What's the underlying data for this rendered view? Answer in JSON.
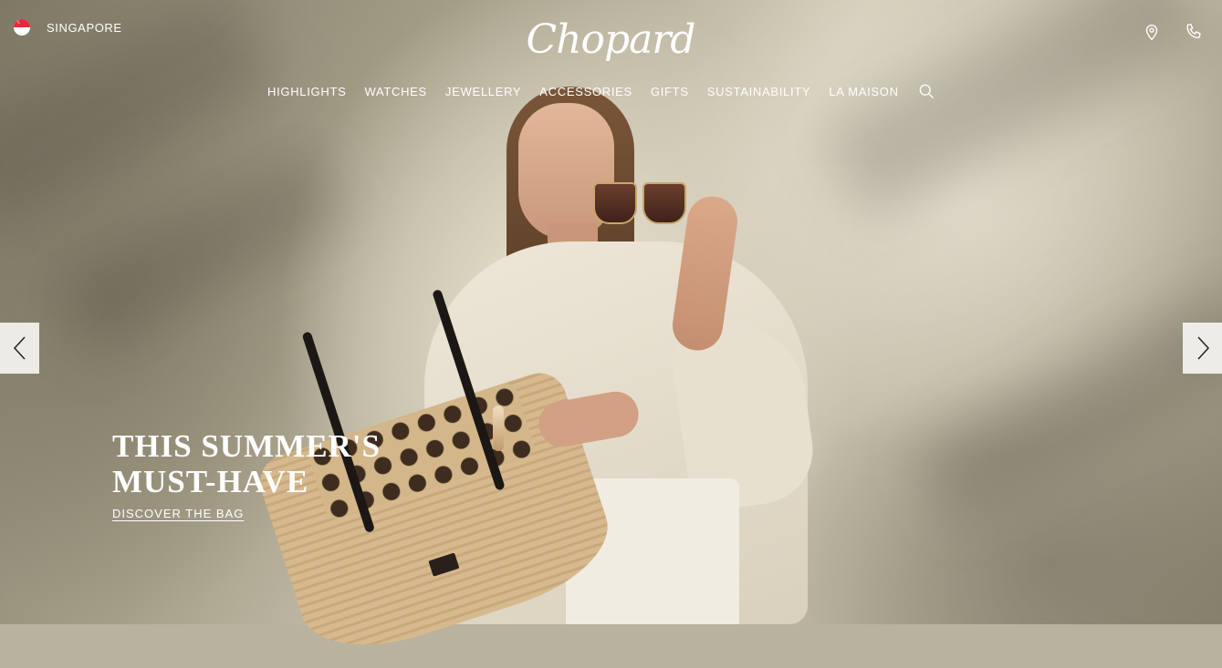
{
  "header": {
    "country_label": "SINGAPORE",
    "logo_text": "Chopard",
    "icons": [
      "location-pin-icon",
      "phone-icon"
    ]
  },
  "nav": {
    "items": [
      {
        "label": "HIGHLIGHTS"
      },
      {
        "label": "WATCHES"
      },
      {
        "label": "JEWELLERY"
      },
      {
        "label": "ACCESSORIES"
      },
      {
        "label": "GIFTS"
      },
      {
        "label": "SUSTAINABILITY"
      },
      {
        "label": "LA MAISON"
      }
    ],
    "search_icon": "search-icon"
  },
  "hero": {
    "title_line1": "THIS SUMMER'S",
    "title_line2": "MUST-HAVE",
    "cta_label": "DISCOVER THE BAG",
    "prev_icon": "chevron-left-icon",
    "next_icon": "chevron-right-icon"
  },
  "colors": {
    "text_on_image": "#ffffff",
    "arrow_bg": "#f5f4f0",
    "flag_red": "#e32b3b"
  }
}
